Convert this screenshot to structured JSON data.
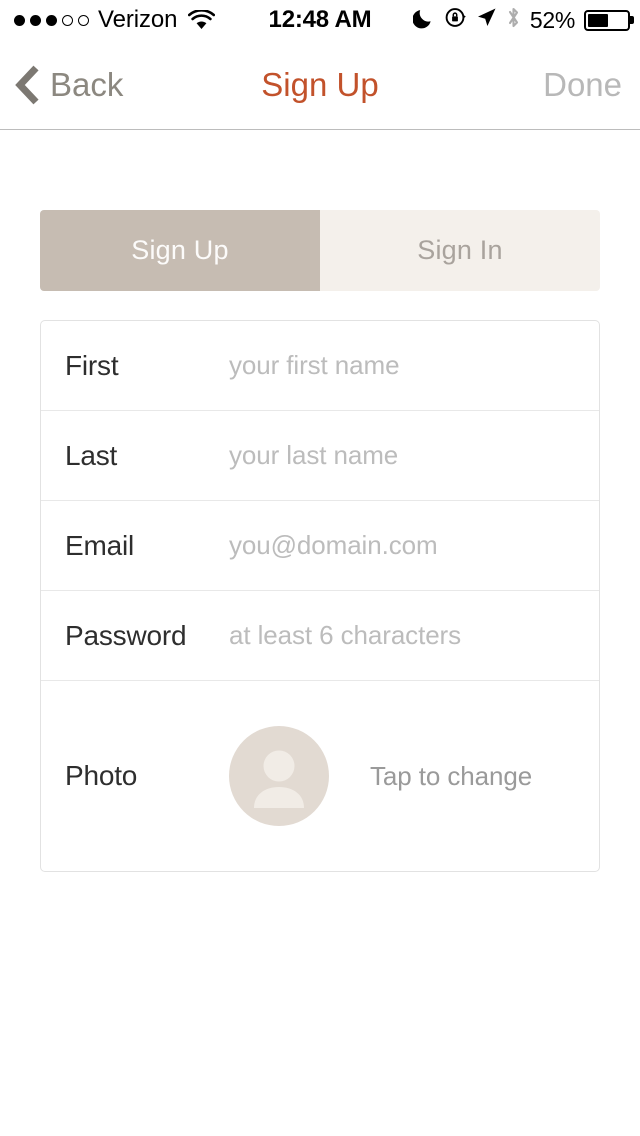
{
  "status_bar": {
    "carrier": "Verizon",
    "signal_bars_filled": 3,
    "signal_bars_total": 5,
    "wifi_icon": "wifi-icon",
    "time": "12:48 AM",
    "do_not_disturb_icon": "moon-icon",
    "rotation_lock_icon": "rotation-lock-icon",
    "location_icon": "location-arrow-icon",
    "bluetooth_icon": "bluetooth-icon",
    "battery_percent": "52%",
    "battery_level": 52
  },
  "nav_bar": {
    "back_label": "Back",
    "back_icon": "chevron-left-icon",
    "title": "Sign Up",
    "done_label": "Done",
    "title_color": "#c2522b",
    "done_color": "#b8b8b8"
  },
  "segmented_control": {
    "selected_index": 0,
    "selected_bg": "#c6bcb2",
    "unselected_bg": "#f4f0eb",
    "segments": [
      {
        "label": "Sign Up",
        "selected": true
      },
      {
        "label": "Sign In",
        "selected": false
      }
    ]
  },
  "form": {
    "fields": [
      {
        "label": "First",
        "placeholder": "your first name",
        "value": ""
      },
      {
        "label": "Last",
        "placeholder": "your last name",
        "value": ""
      },
      {
        "label": "Email",
        "placeholder": "you@domain.com",
        "value": ""
      },
      {
        "label": "Password",
        "placeholder": "at least 6 characters",
        "value": ""
      }
    ],
    "photo": {
      "label": "Photo",
      "hint": "Tap to change",
      "avatar_icon": "person-placeholder-icon",
      "avatar_bg": "#e2dad2",
      "avatar_fg": "#f1ece6"
    }
  }
}
